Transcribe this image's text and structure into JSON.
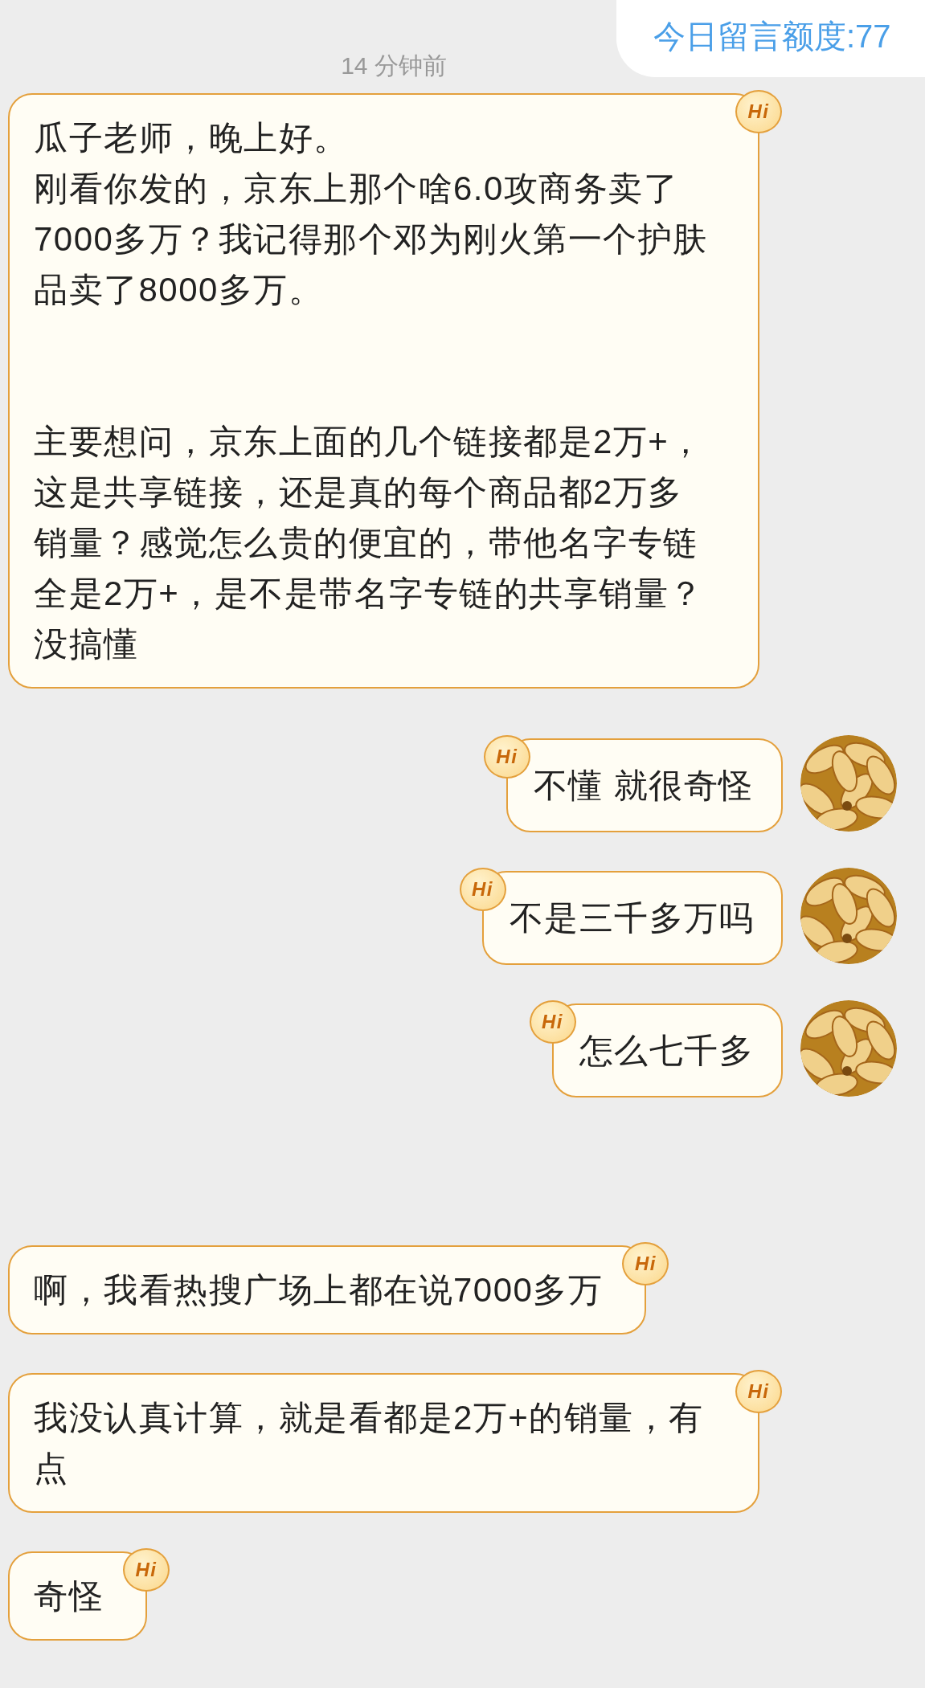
{
  "quota": {
    "label": "今日留言额度:77"
  },
  "timestamp": "14 分钟前",
  "messages": [
    {
      "kind": "in",
      "paragraphs": [
        "瓜子老师，晚上好。",
        "刚看你发的，京东上那个啥6.0攻商务卖了7000多万？我记得那个邓为刚火第一个护肤品卖了8000多万。",
        "主要想问，京东上面的几个链接都是2万+，这是共享链接，还是真的每个商品都2万多销量？感觉怎么贵的便宜的，带他名字专链全是2万+，是不是带名字专链的共享销量？没搞懂"
      ],
      "badge": "Hi"
    },
    {
      "kind": "out",
      "paragraphs": [
        "不懂 就很奇怪"
      ],
      "badge": "Hi"
    },
    {
      "kind": "out",
      "paragraphs": [
        "不是三千多万吗"
      ],
      "badge": "Hi"
    },
    {
      "kind": "out",
      "paragraphs": [
        "怎么七千多"
      ],
      "badge": "Hi"
    },
    {
      "kind": "in",
      "paragraphs": [
        "啊，我看热搜广场上都在说7000多万"
      ],
      "badge": "Hi"
    },
    {
      "kind": "in",
      "paragraphs": [
        "我没认真计算，就是看都是2万+的销量，有点"
      ],
      "badge": "Hi"
    },
    {
      "kind": "in",
      "paragraphs": [
        "奇怪"
      ],
      "badge": "Hi"
    }
  ]
}
